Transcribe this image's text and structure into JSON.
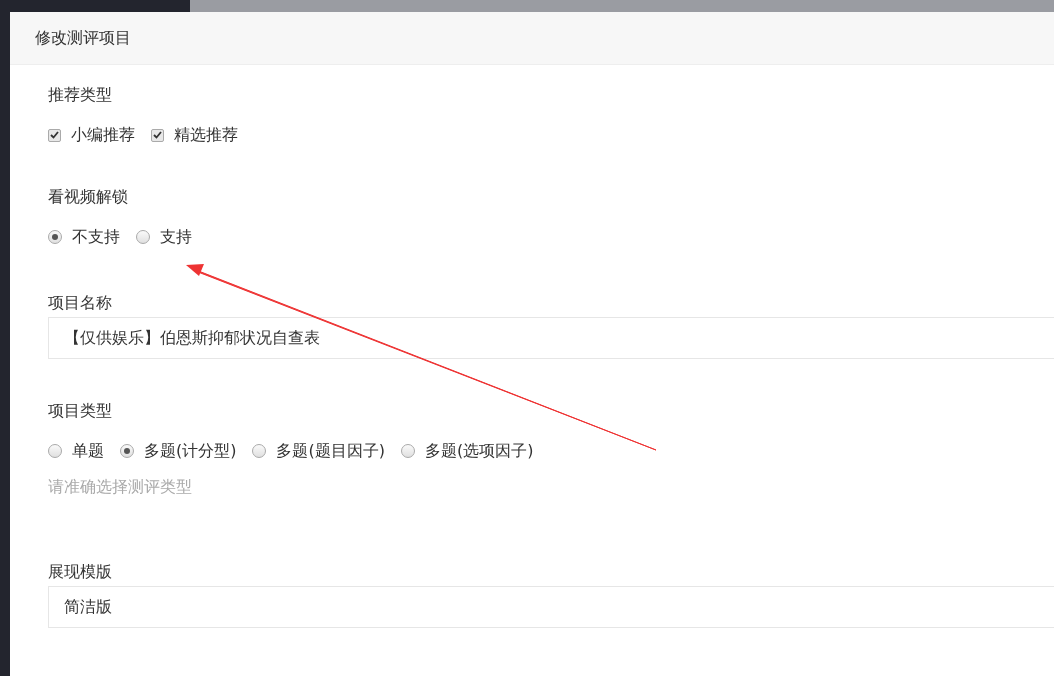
{
  "dialog": {
    "title": "修改测评项目"
  },
  "recommend_type": {
    "label": "推荐类型",
    "options": [
      {
        "label": "小编推荐",
        "checked": true
      },
      {
        "label": "精选推荐",
        "checked": true
      }
    ]
  },
  "video_unlock": {
    "label": "看视频解锁",
    "options": [
      {
        "label": "不支持",
        "selected": true
      },
      {
        "label": "支持",
        "selected": false
      }
    ]
  },
  "project_name": {
    "label": "项目名称",
    "value": "【仅供娱乐】伯恩斯抑郁状况自查表"
  },
  "project_type": {
    "label": "项目类型",
    "options": [
      {
        "label": "单题",
        "selected": false
      },
      {
        "label": "多题(计分型)",
        "selected": true
      },
      {
        "label": "多题(题目因子)",
        "selected": false
      },
      {
        "label": "多题(选项因子)",
        "selected": false
      }
    ],
    "hint": "请准确选择测评类型"
  },
  "display_template": {
    "label": "展现模版",
    "value": "简洁版"
  }
}
